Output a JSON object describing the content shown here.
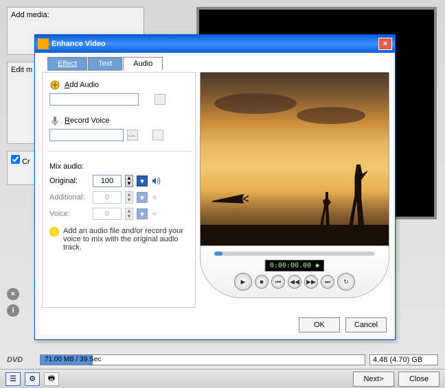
{
  "background": {
    "add_media_label": "Add media:",
    "edit_label": "Edit m",
    "create_label": "Cr"
  },
  "dialog": {
    "title": "Enhance Video",
    "close": "×",
    "tabs": {
      "effect": "Effect",
      "text": "Text",
      "audio": "Audio"
    },
    "add_audio": {
      "label": "Add Audio",
      "value": ""
    },
    "record_voice": {
      "label": "Record Voice",
      "value": "",
      "underline": "R"
    },
    "mix": {
      "title": "Mix audio:",
      "rows": [
        {
          "label": "Original:",
          "value": "100",
          "enabled": true
        },
        {
          "label": "Additional:",
          "value": "0",
          "enabled": false
        },
        {
          "label": "Voice:",
          "value": "0",
          "enabled": false
        }
      ],
      "hint": "Add an audio file and/or record your voice to mix with the original audio track."
    },
    "timecode": "0:00:00.00 ◆",
    "buttons": {
      "ok": "OK",
      "cancel": "Cancel"
    }
  },
  "status": {
    "dvd": "DVD",
    "progress": "71.00 MB / 39 Sec",
    "capacity": "4.48 (4.70) GB"
  },
  "bottom": {
    "next": "Next>",
    "close": "Close"
  }
}
